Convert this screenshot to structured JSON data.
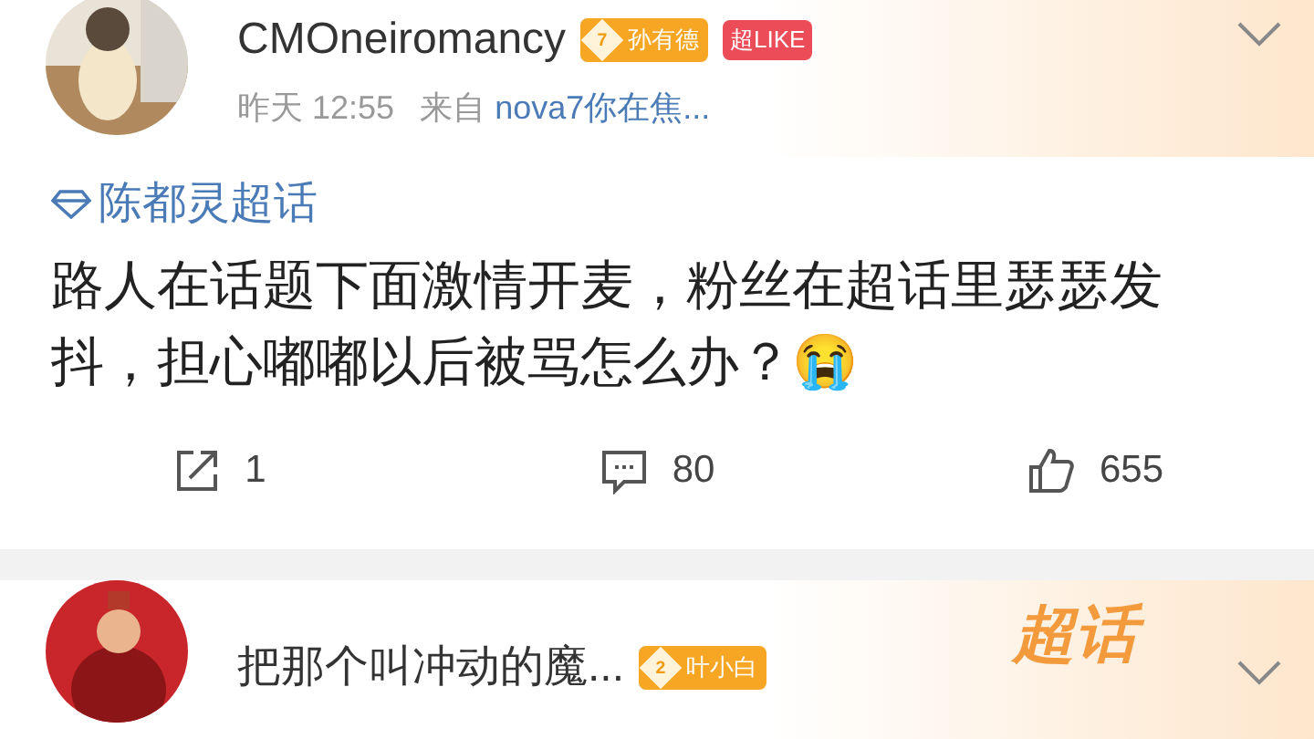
{
  "posts": [
    {
      "author": "CMOneiromancy",
      "badges": [
        {
          "kind": "level",
          "level_text": "7",
          "label": "孙有德"
        },
        {
          "kind": "like",
          "label": "超LIKE"
        }
      ],
      "time": "昨天 12:55",
      "source_prefix": "来自",
      "source": "nova7你在焦...",
      "topic": "陈都灵超话",
      "body": "路人在话题下面激情开麦，粉丝在超话里瑟瑟发抖，担心嘟嘟以后被骂怎么办？😭",
      "actions": [
        {
          "kind": "repost",
          "count": "1"
        },
        {
          "kind": "comment",
          "count": "80"
        },
        {
          "kind": "like",
          "count": "655"
        }
      ]
    },
    {
      "author": "把那个叫冲动的魔...",
      "badges": [
        {
          "kind": "level",
          "level_text": "2",
          "label": "叶小白"
        }
      ],
      "corner_label": "超话"
    }
  ]
}
